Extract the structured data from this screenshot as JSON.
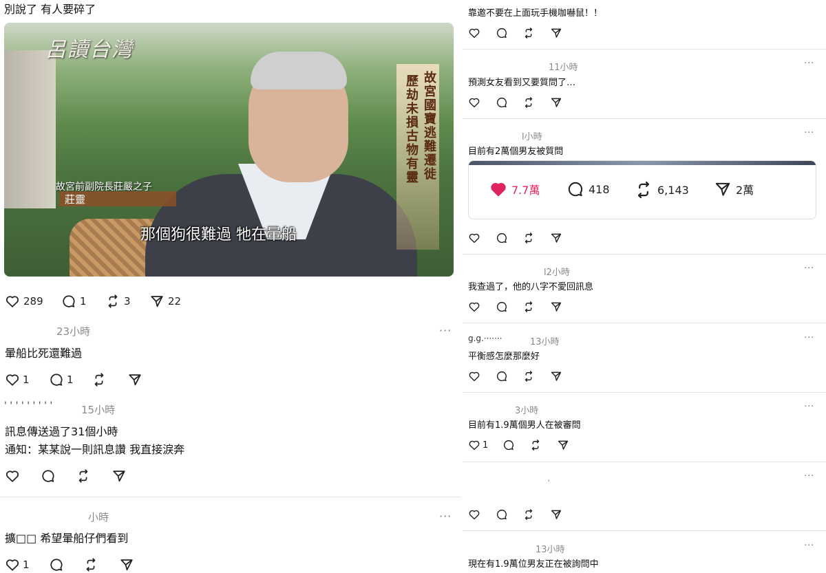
{
  "left": {
    "top_text": "別說了 有人要碎了",
    "video": {
      "logo": "呂讀台灣",
      "side_title_1": "故宮國寶逃難遷徙",
      "side_title_2": "歷劫未損古物有靈",
      "caption_role": "故宮前副院長莊嚴之子",
      "caption_name": "莊靈",
      "subtitle": "那個狗很難過 牠在暈船"
    },
    "post_stats": {
      "likes": "289",
      "replies": "1",
      "reposts": "3",
      "shares": "22"
    },
    "comments": [
      {
        "time": "23小時",
        "lines": [
          "暈船比死還難過"
        ],
        "likes": "1",
        "replies": "1",
        "reposts": "",
        "user_fragment": ""
      },
      {
        "time": "15小時",
        "lines": [
          "訊息傳送過了31個小時",
          "通知：某某說一則訊息讚 我直接淚奔"
        ],
        "likes": "",
        "replies": "",
        "reposts": "",
        "user_fragment": "' ' ' '  ' ' ' ' '"
      },
      {
        "time": "小時",
        "lines": [
          "擴□□ 希望暈船仔們看到"
        ],
        "likes": "1",
        "replies": "",
        "reposts": "",
        "user_fragment": ""
      }
    ],
    "more_label": "···"
  },
  "right": {
    "more_label": "···",
    "items": [
      {
        "time": "",
        "text": "靠邀不要在上面玩手機咖嚇鼠！！",
        "likes": ""
      },
      {
        "time": "11小時",
        "text": "預測女友看到又要質問了…",
        "likes": ""
      },
      {
        "time": "l小時",
        "text": "目前有2萬個男友被質問",
        "likes": ""
      },
      {
        "time": "l2小時",
        "text": "我查過了，他的八字不愛回訊息",
        "likes": ""
      },
      {
        "time": "13小時",
        "text": "平衡感怎麼那麼好",
        "likes": "",
        "user_fragment": "g.g.·······"
      },
      {
        "time": "3小時",
        "text": "目前有1.9萬個男人在被審問",
        "likes": "1"
      },
      {
        "time": "",
        "text": "",
        "likes": "",
        "user_fragment": "ͅ"
      },
      {
        "time": "13小時",
        "text": "現在有1.9萬位男友正在被詢問中",
        "likes": ""
      }
    ],
    "embed_stats": {
      "likes": "7.7萬",
      "replies": "418",
      "reposts": "6,143",
      "shares": "2萬",
      "like_color": "#e0245e"
    }
  },
  "icons": [
    "heart-icon",
    "comment-icon",
    "repost-icon",
    "share-icon",
    "more-icon"
  ]
}
